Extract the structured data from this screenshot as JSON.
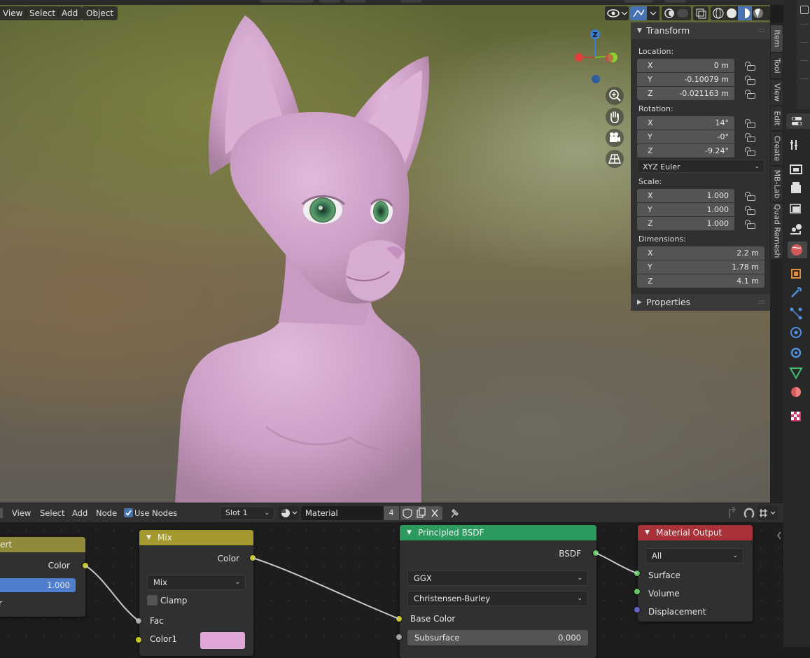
{
  "viewport": {
    "menu": [
      "View",
      "Select",
      "Add",
      "Object"
    ],
    "gizmo_axis_z": "Z",
    "nav_icons": [
      "zoom-icon",
      "hand-icon",
      "camera-icon",
      "grid-icon"
    ]
  },
  "n_panel": {
    "transform_title": "Transform",
    "location_label": "Location:",
    "location": [
      {
        "axis": "X",
        "value": "0 m"
      },
      {
        "axis": "Y",
        "value": "-0.10079 m"
      },
      {
        "axis": "Z",
        "value": "-0.021163 m"
      }
    ],
    "rotation_label": "Rotation:",
    "rotation": [
      {
        "axis": "X",
        "value": "14°"
      },
      {
        "axis": "Y",
        "value": "-0°"
      },
      {
        "axis": "Z",
        "value": "-9.24°"
      }
    ],
    "rotation_mode": "XYZ Euler",
    "scale_label": "Scale:",
    "scale": [
      {
        "axis": "X",
        "value": "1.000"
      },
      {
        "axis": "Y",
        "value": "1.000"
      },
      {
        "axis": "Z",
        "value": "1.000"
      }
    ],
    "dimensions_label": "Dimensions:",
    "dimensions": [
      {
        "axis": "X",
        "value": "2.2 m"
      },
      {
        "axis": "Y",
        "value": "1.78 m"
      },
      {
        "axis": "Z",
        "value": "4.1 m"
      }
    ],
    "properties_title": "Properties"
  },
  "sidebar_tabs": [
    "Item",
    "Tool",
    "View",
    "Edit",
    "Create",
    "MB-Lab",
    "Quad Remesh"
  ],
  "node_header": {
    "menu": [
      "View",
      "Select",
      "Add",
      "Node"
    ],
    "use_nodes_label": "Use Nodes",
    "slot": "Slot 1",
    "material_name": "Material",
    "user_count": "4"
  },
  "nodes": {
    "invert": {
      "title": "ert",
      "color_out": "Color",
      "fac_value": "1.000",
      "color_in": "r"
    },
    "mix": {
      "title": "Mix",
      "color_out": "Color",
      "blend_mode": "Mix",
      "clamp_label": "Clamp",
      "fac_label": "Fac",
      "color1_label": "Color1",
      "color1_swatch": "#e0a6d6"
    },
    "principled": {
      "title": "Principled BSDF",
      "bsdf_out": "BSDF",
      "distribution": "GGX",
      "subsurface_method": "Christensen-Burley",
      "base_color_label": "Base Color",
      "subsurface_label": "Subsurface",
      "subsurface_value": "0.000"
    },
    "output": {
      "title": "Material Output",
      "target": "All",
      "surface_label": "Surface",
      "volume_label": "Volume",
      "displacement_label": "Displacement"
    }
  },
  "colors": {
    "invert_header": "#8f8a3a",
    "mix_header": "#a4992c",
    "principled_header": "#2c9a5e",
    "output_header": "#a83237",
    "skin": "#d4a6cf",
    "fac_bar": "#4f7fcc"
  }
}
